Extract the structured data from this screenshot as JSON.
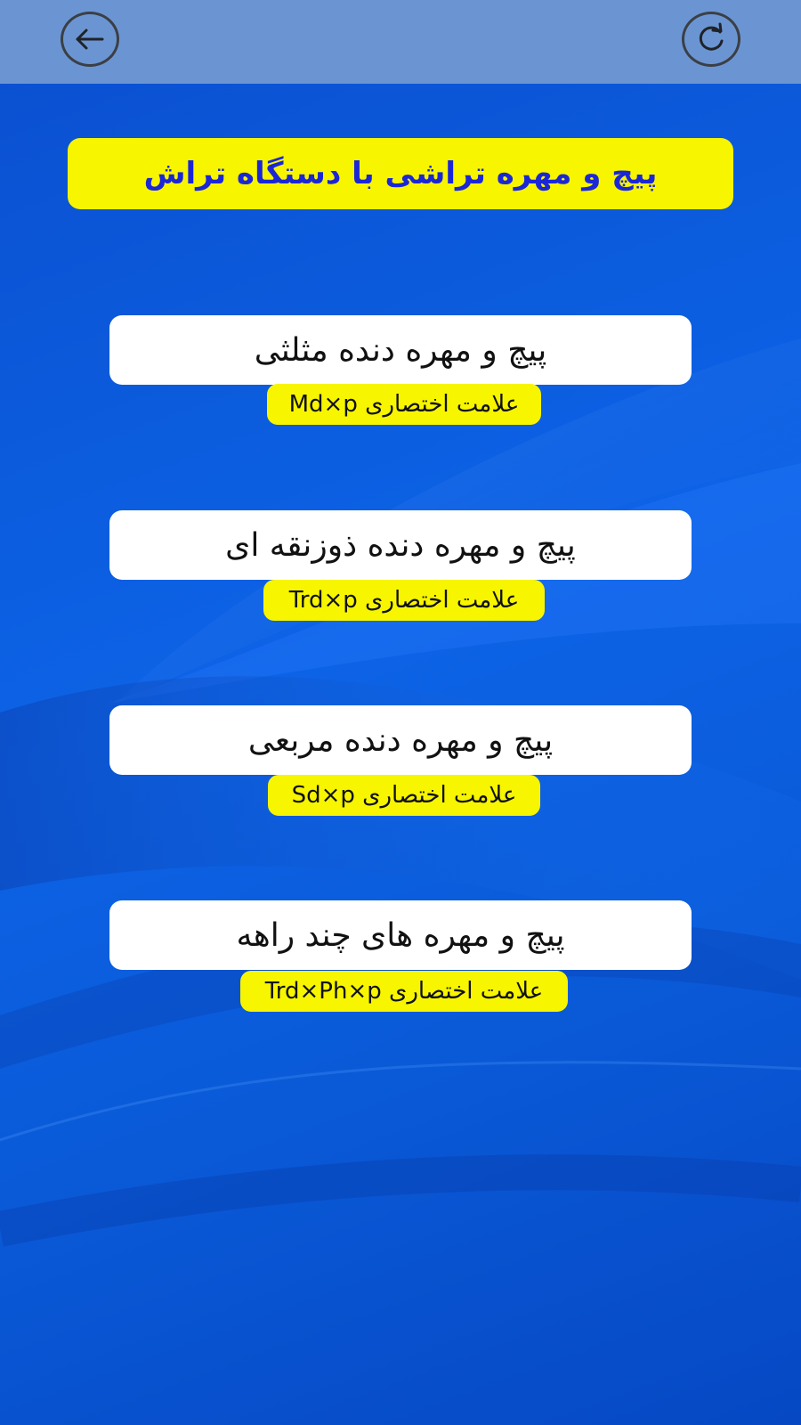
{
  "toolbar": {
    "back_icon": "arrow-left-icon",
    "refresh_icon": "refresh-icon",
    "color": "#6b95d2"
  },
  "header": {
    "title": "پیچ و مهره تراشی با دستگاه تراش",
    "title_color": "#1b27d6",
    "banner_color": "#f7f500"
  },
  "items": [
    {
      "label": "پیچ و مهره دنده مثلثی",
      "abbr": "علامت اختصاری Md×p"
    },
    {
      "label": "پیچ و مهره دنده ذوزنقه ای",
      "abbr": "علامت اختصاری Trd×p"
    },
    {
      "label": "پیچ و مهره دنده مربعی",
      "abbr": "علامت اختصاری Sd×p"
    },
    {
      "label": "پیچ و مهره های چند راهه",
      "abbr": "علامت اختصاری Trd×Ph×p"
    }
  ]
}
